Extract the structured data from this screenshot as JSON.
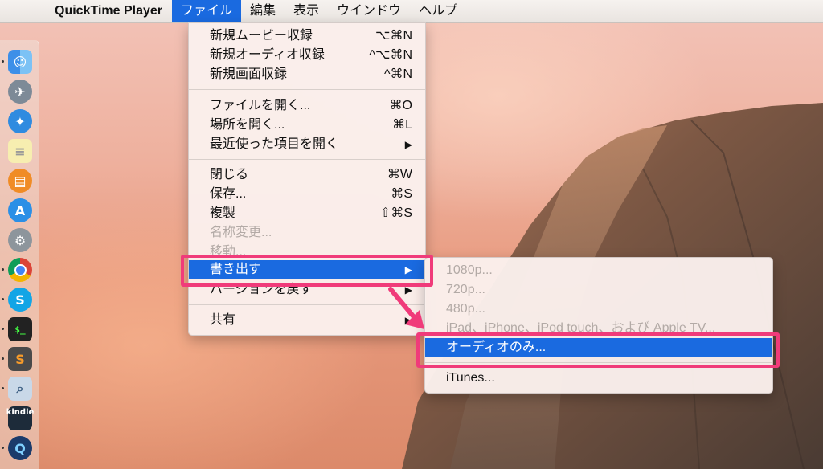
{
  "menubar": {
    "apple_icon": "apple-logo-icon",
    "app_name": "QuickTime Player",
    "menus": [
      "ファイル",
      "編集",
      "表示",
      "ウインドウ",
      "ヘルプ"
    ]
  },
  "file_menu": {
    "items": [
      {
        "label": "新規ムービー収録",
        "shortcut": "⌥⌘N",
        "enabled": true
      },
      {
        "label": "新規オーディオ収録",
        "shortcut": "^⌥⌘N",
        "enabled": true
      },
      {
        "label": "新規画面収録",
        "shortcut": "^⌘N",
        "enabled": true
      },
      {
        "label": "ファイルを開く...",
        "shortcut": "⌘O",
        "enabled": true
      },
      {
        "label": "場所を開く...",
        "shortcut": "⌘L",
        "enabled": true
      },
      {
        "label": "最近使った項目を開く",
        "shortcut": "▶",
        "enabled": true
      },
      {
        "label": "閉じる",
        "shortcut": "⌘W",
        "enabled": true
      },
      {
        "label": "保存...",
        "shortcut": "⌘S",
        "enabled": true
      },
      {
        "label": "複製",
        "shortcut": "⇧⌘S",
        "enabled": true
      },
      {
        "label": "名称変更...",
        "shortcut": "",
        "enabled": false
      },
      {
        "label": "移動...",
        "shortcut": "",
        "enabled": false
      },
      {
        "label": "書き出す",
        "shortcut": "▶",
        "enabled": true,
        "highlighted": true
      },
      {
        "label": "バージョンを戻す",
        "shortcut": "▶",
        "enabled": true
      },
      {
        "label": "共有",
        "shortcut": "▶",
        "enabled": true
      }
    ]
  },
  "export_submenu": {
    "items": [
      {
        "label": "1080p...",
        "enabled": false
      },
      {
        "label": "720p...",
        "enabled": false
      },
      {
        "label": "480p...",
        "enabled": false
      },
      {
        "label": "iPad、iPhone、iPod touch、および Apple TV...",
        "enabled": false
      },
      {
        "label": "オーディオのみ...",
        "enabled": true,
        "highlighted": true
      },
      {
        "label": "iTunes...",
        "enabled": true
      }
    ]
  },
  "dock": {
    "items": [
      "finder-icon",
      "launchpad-icon",
      "safari-icon",
      "notes-icon",
      "ibooks-icon",
      "app-store-icon",
      "system-preferences-icon",
      "chrome-icon",
      "skype-icon",
      "terminal-icon",
      "sublime-text-icon",
      "preview-icon",
      "kindle-icon",
      "quicktime-icon"
    ],
    "kindle_label": "kindle"
  },
  "colors": {
    "highlight": "#1a6ae0",
    "callout": "#f03b7a"
  }
}
